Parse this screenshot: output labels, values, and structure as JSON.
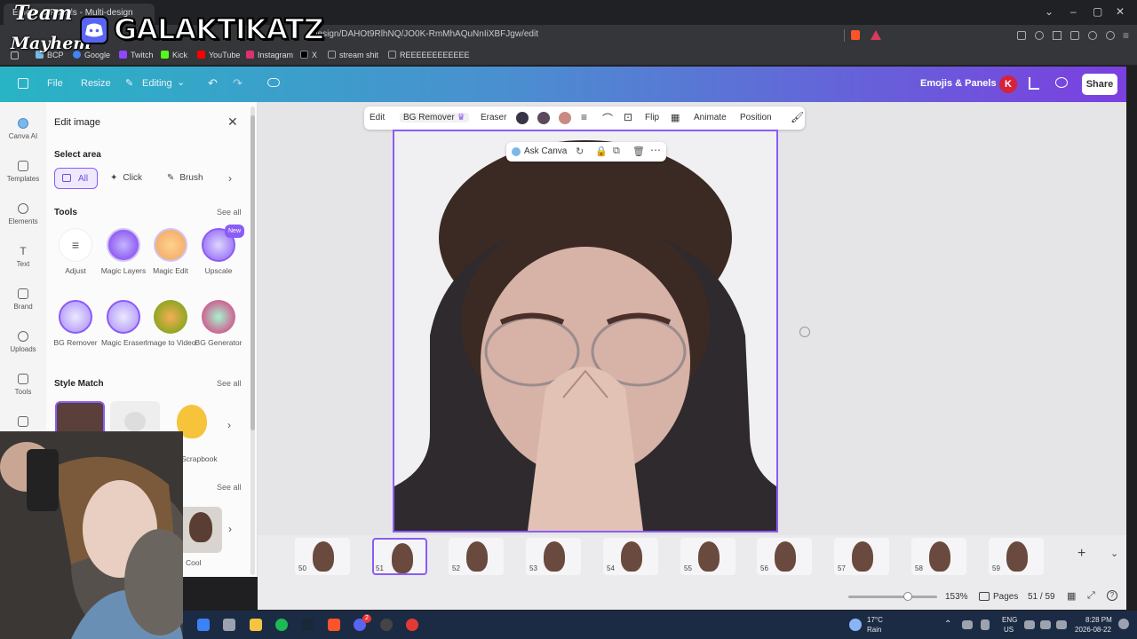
{
  "browser": {
    "tab_title": "Emojis & Panels - Multi-design",
    "url": "design/DAHOt9RlhNQ/JO0K-RmMhAQuNnIiXBFJgw/edit",
    "bookmarks": [
      {
        "label": "BCP",
        "color": "#7ab8e8"
      },
      {
        "label": "Google",
        "color": "#4285f4"
      },
      {
        "label": "Twitch",
        "color": "#9146ff"
      },
      {
        "label": "Kick",
        "color": "#53fc18"
      },
      {
        "label": "YouTube",
        "color": "#ff0000"
      },
      {
        "label": "Instagram",
        "color": "#e1306c"
      },
      {
        "label": "X",
        "color": "#000000"
      },
      {
        "label": "stream shit",
        "color": "#9aa0a6"
      },
      {
        "label": "REEEEEEEEEEEE",
        "color": "#9aa0a6"
      }
    ]
  },
  "overlay": {
    "team": "Team",
    "mayhem": "Mayhem",
    "channel": "GALAKTIKATZ"
  },
  "header": {
    "file": "File",
    "resize": "Resize",
    "editing": "Editing",
    "project_name": "Emojis & Panels",
    "avatar_initial": "K",
    "share": "Share"
  },
  "rail": [
    {
      "label": "Canva AI",
      "icon": "canva-ai-icon"
    },
    {
      "label": "Templates",
      "icon": "templates-icon"
    },
    {
      "label": "Elements",
      "icon": "elements-icon"
    },
    {
      "label": "Text",
      "icon": "text-icon"
    },
    {
      "label": "Brand",
      "icon": "brand-icon"
    },
    {
      "label": "Uploads",
      "icon": "uploads-icon"
    },
    {
      "label": "Tools",
      "icon": "tools-icon"
    }
  ],
  "panel": {
    "title": "Edit image",
    "select_area": "Select area",
    "chips": [
      "All",
      "Click",
      "Brush"
    ],
    "tools_heading": "Tools",
    "see_all": "See all",
    "new_badge": "New",
    "tools": [
      {
        "label": "Adjust",
        "color": "#ffffff"
      },
      {
        "label": "Magic Layers",
        "color": "#a78bfa"
      },
      {
        "label": "Magic Edit",
        "color": "#f4a261"
      },
      {
        "label": "Upscale",
        "color": "#8b5cf6"
      },
      {
        "label": "BG Remover",
        "color": "#c4b5fd"
      },
      {
        "label": "Magic Eraser",
        "color": "#c4b5fd"
      },
      {
        "label": "Image to Video",
        "color": "#9acd32"
      },
      {
        "label": "BG Generator",
        "color": "#ec4899"
      }
    ],
    "style_match": "Style Match",
    "style_items": [
      "",
      "Scrapbook",
      "Cool"
    ]
  },
  "toolbar": {
    "edit": "Edit",
    "bg_remover": "BG Remover",
    "eraser": "Eraser",
    "flip": "Flip",
    "animate": "Animate",
    "position": "Position",
    "swatches": [
      "#3b3348",
      "#5b4a5c",
      "#c98a84"
    ]
  },
  "ask_canva": "Ask Canva",
  "filmstrip": {
    "pages": [
      "50",
      "51",
      "52",
      "53",
      "54",
      "55",
      "56",
      "57",
      "58",
      "59"
    ],
    "selected": "51"
  },
  "footer": {
    "zoom": "153%",
    "pages_label": "Pages",
    "page_count": "51 / 59"
  },
  "taskbar": {
    "weather_temp": "17°C",
    "weather_cond": "Rain",
    "lang": "ENG",
    "region": "US",
    "time": "8:28 PM",
    "date": "2026-08-22",
    "notif_count": "2"
  }
}
